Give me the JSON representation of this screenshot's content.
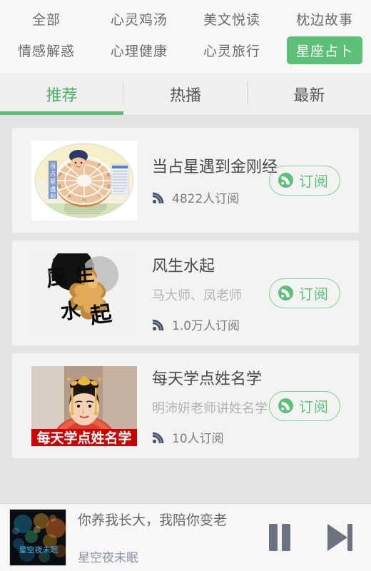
{
  "categories": {
    "rows": [
      [
        {
          "label": "全部",
          "active": false
        },
        {
          "label": "心灵鸡汤",
          "active": false
        },
        {
          "label": "美文悦读",
          "active": false
        },
        {
          "label": "枕边故事",
          "active": false
        }
      ],
      [
        {
          "label": "情感解惑",
          "active": false
        },
        {
          "label": "心理健康",
          "active": false
        },
        {
          "label": "心灵旅行",
          "active": false
        },
        {
          "label": "星座占卜",
          "active": true
        }
      ]
    ],
    "active_label": "星座占卜"
  },
  "tabs": [
    {
      "label": "推荐",
      "active": true
    },
    {
      "label": "热播",
      "active": false
    },
    {
      "label": "最新",
      "active": false
    }
  ],
  "list": [
    {
      "title": "当占星遇到金刚经",
      "subtitle": "",
      "subscribers": "4822人订阅",
      "subscribe_label": "订阅",
      "thumb_icon": "astrology-wheel-cover"
    },
    {
      "title": "风生水起",
      "subtitle": "马大师、凤老师",
      "subscribers": "1.0万人订阅",
      "subscribe_label": "订阅",
      "thumb_icon": "calligraphy-figure-cover"
    },
    {
      "title": "每天学点姓名学",
      "subtitle": "明沛妍老师讲姓名学",
      "subscribers": "10人订阅",
      "subscribe_label": "订阅",
      "thumb_icon": "portrait-red-banner-cover"
    }
  ],
  "player": {
    "title": "你养我长大，我陪你变老",
    "album": "星空夜未眠",
    "thumb_icon": "bokeh-night-cover",
    "pause_icon": "pause-icon",
    "next_icon": "next-track-icon"
  },
  "colors": {
    "accent_green": "#5cc177",
    "accent_green_light": "#7fd394",
    "page_bg": "#e3e3e3",
    "card_bg": "#f3f3f3",
    "title_text": "#4a4a4a",
    "sub_text": "#b3b3b3",
    "meta_text": "#7d7d7d",
    "control_gray": "#6b7280"
  }
}
